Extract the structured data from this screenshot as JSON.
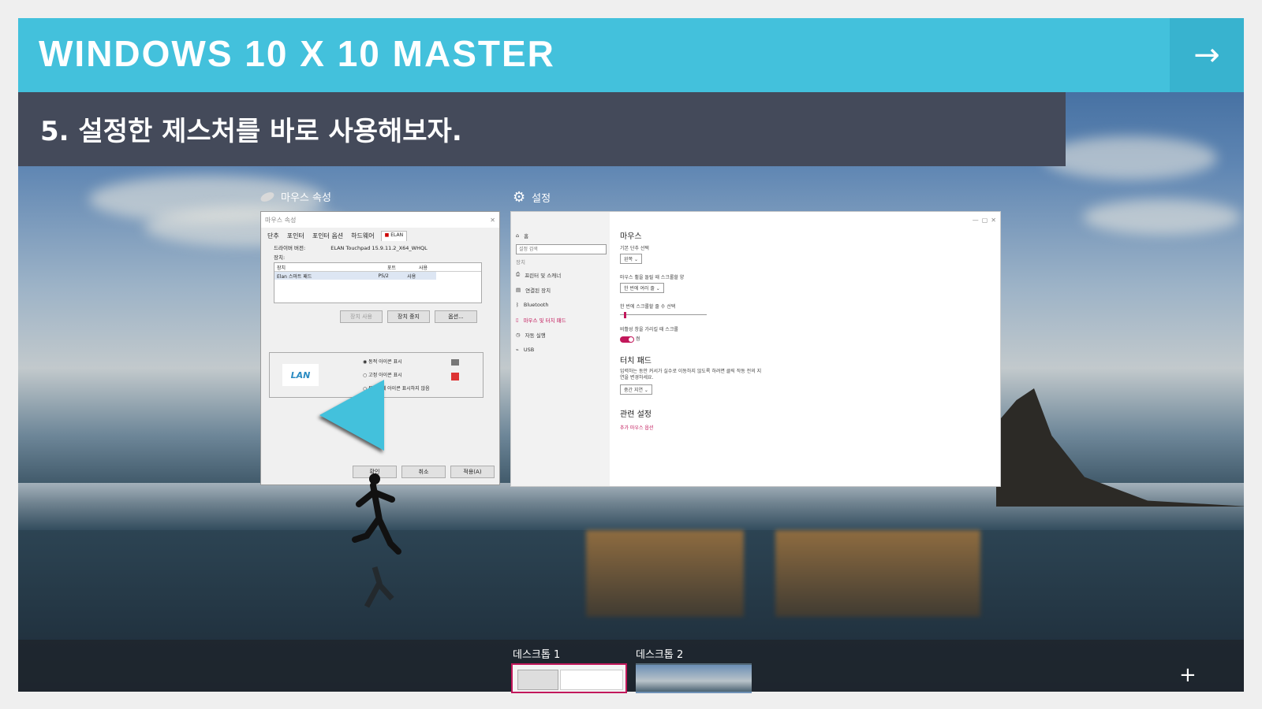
{
  "header": {
    "title": "WINDOWS 10 X 10 MASTER",
    "next_icon": "→"
  },
  "subheader": {
    "title": "5. 설정한 제스처를 바로 사용해보자."
  },
  "colors": {
    "accent": "#43c1dc",
    "subbar": "#444a5a",
    "highlight": "#c2185b"
  },
  "mouse_window": {
    "label": "마우스 속성",
    "title": "마우스 속성",
    "tabs": [
      "단추",
      "포인터",
      "포인터 옵션",
      "하드웨어",
      "ELAN"
    ],
    "driver_label": "드라이버 버전:",
    "driver_value": "ELAN Touchpad 15.9.11.2_X64_WHQL",
    "device_label": "장치:",
    "columns": [
      "장치",
      "포트",
      "사용"
    ],
    "rows": [
      {
        "device": "Elan 스마트 패드",
        "port": "PS/2",
        "use": "사용"
      }
    ],
    "buttons": [
      "장치 사용",
      "장치 중지",
      "옵션..."
    ],
    "brand": "LAN",
    "options": [
      "동적 아이콘 표시",
      "고정 아이콘 표시",
      "트레이에 아이콘 표시하지 않음"
    ],
    "footer_buttons": [
      "확인",
      "취소",
      "적용(A)"
    ]
  },
  "settings_window": {
    "label": "설정",
    "title": "설정",
    "home": "홈",
    "search_placeholder": "설정 검색",
    "group": "장치",
    "nav": [
      "프린터 및 스캐너",
      "연결된 장치",
      "Bluetooth",
      "마우스 및 터치 패드",
      "자동 실행",
      "USB"
    ],
    "mouse_heading": "마우스",
    "primary_label": "기본 단추 선택",
    "primary_value": "왼쪽",
    "wheel_label": "마우스 휠을 돌릴 때 스크롤할 양",
    "wheel_value": "한 번에 여러 줄",
    "lines_label": "한 번에 스크롤할 줄 수 선택",
    "lines_level": 0.05,
    "inactive_label": "비활성 창을 가리킬 때 스크롤",
    "toggle_value": "켬",
    "touchpad_heading": "터치 패드",
    "touchpad_desc": "입력하는 동안 커서가 실수로 이동하지 않도록 하려면 클릭 작동 전의 지연을 변경하세요.",
    "touchpad_value": "중간 지연",
    "related_heading": "관련 설정",
    "related_link": "추가 마우스 옵션"
  },
  "taskbar": {
    "desktops": [
      {
        "label": "데스크톱 1",
        "active": true
      },
      {
        "label": "데스크톱 2",
        "active": false
      }
    ],
    "add_icon": "+"
  }
}
